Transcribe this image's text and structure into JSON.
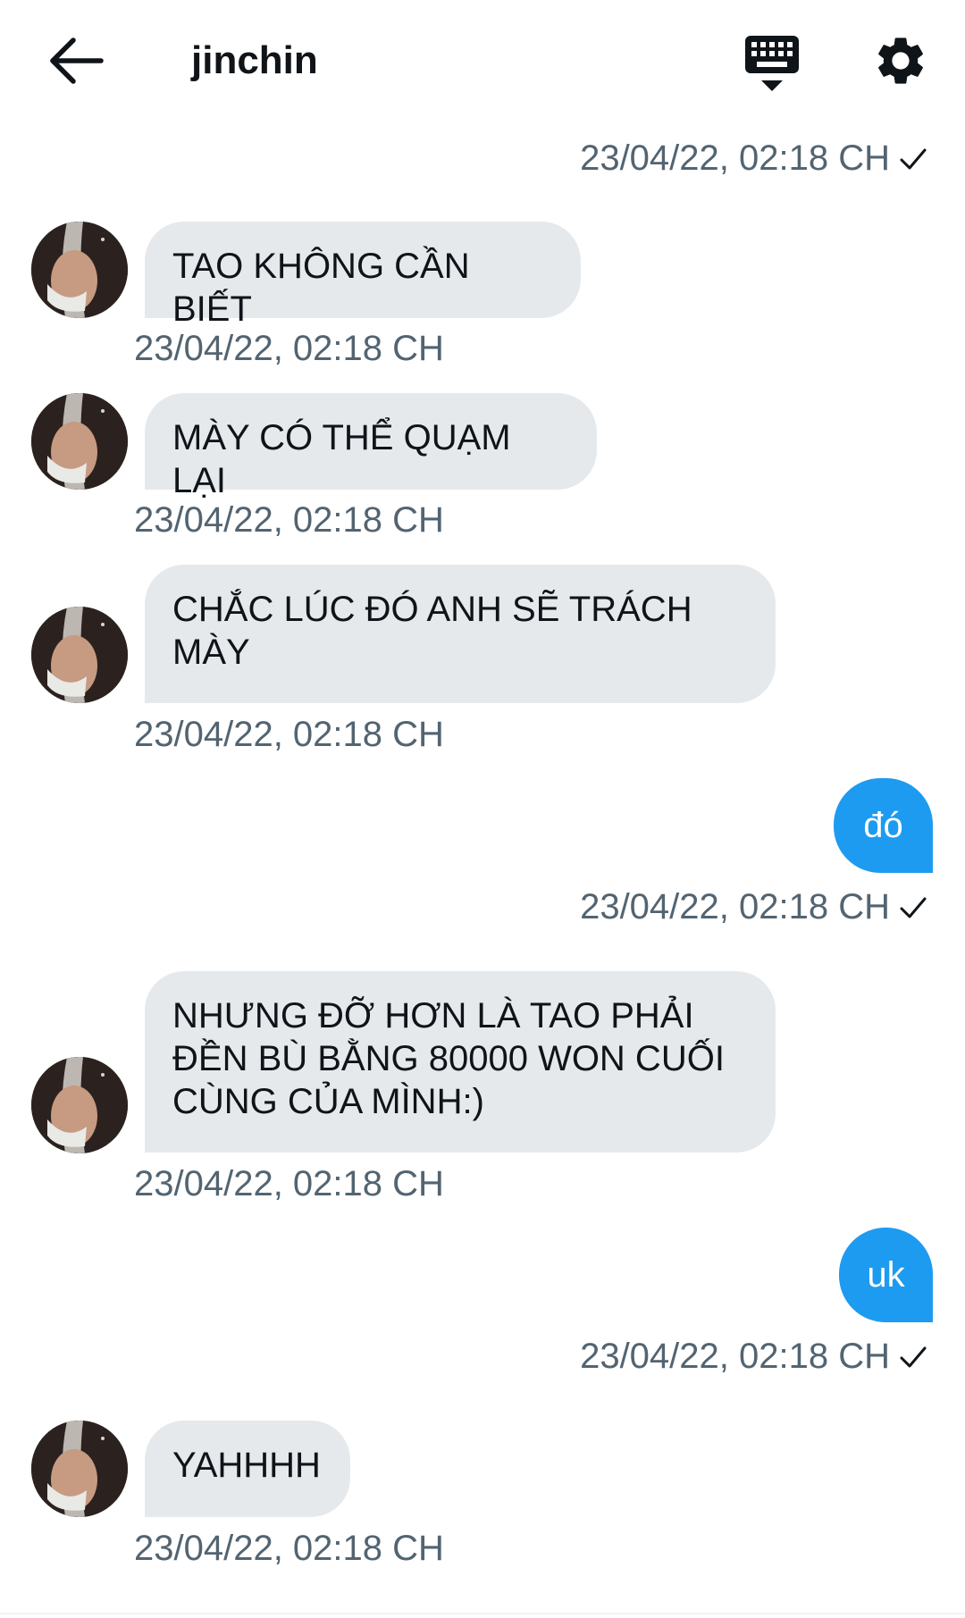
{
  "header": {
    "title": "jinchin",
    "back_icon": "arrow-left-icon",
    "keyboard_icon": "keyboard-icon",
    "settings_icon": "gear-icon"
  },
  "colors": {
    "incoming_bubble": "#e6e9ec",
    "outgoing_bubble": "#1d9bf0",
    "timestamp": "#536471",
    "text": "#0f1419"
  },
  "messages": [
    {
      "direction": "out",
      "timestamp": "23/04/22, 02:18 CH",
      "read_icon": "checkmark-icon"
    },
    {
      "direction": "in",
      "text": "TAO KHÔNG CẦN BIẾT",
      "timestamp": "23/04/22, 02:18 CH"
    },
    {
      "direction": "in",
      "text": "MÀY CÓ THỂ QUẠM LẠI",
      "timestamp": "23/04/22, 02:18 CH"
    },
    {
      "direction": "in",
      "text": "CHẮC LÚC ĐÓ ANH SẼ TRÁCH\nMÀY",
      "timestamp": "23/04/22, 02:18 CH"
    },
    {
      "direction": "out",
      "text": "đó",
      "timestamp": "23/04/22, 02:18 CH",
      "read_icon": "checkmark-icon"
    },
    {
      "direction": "in",
      "text": "NHƯNG ĐỠ HƠN LÀ TAO PHẢI\nĐỀN BÙ BẰNG 80000 WON CUỐI\nCÙNG CỦA MÌNH:)",
      "timestamp": "23/04/22, 02:18 CH"
    },
    {
      "direction": "out",
      "text": "uk",
      "timestamp": "23/04/22, 02:18 CH",
      "read_icon": "checkmark-icon"
    },
    {
      "direction": "in",
      "text": "YAHHHH",
      "timestamp": "23/04/22, 02:18 CH"
    }
  ]
}
